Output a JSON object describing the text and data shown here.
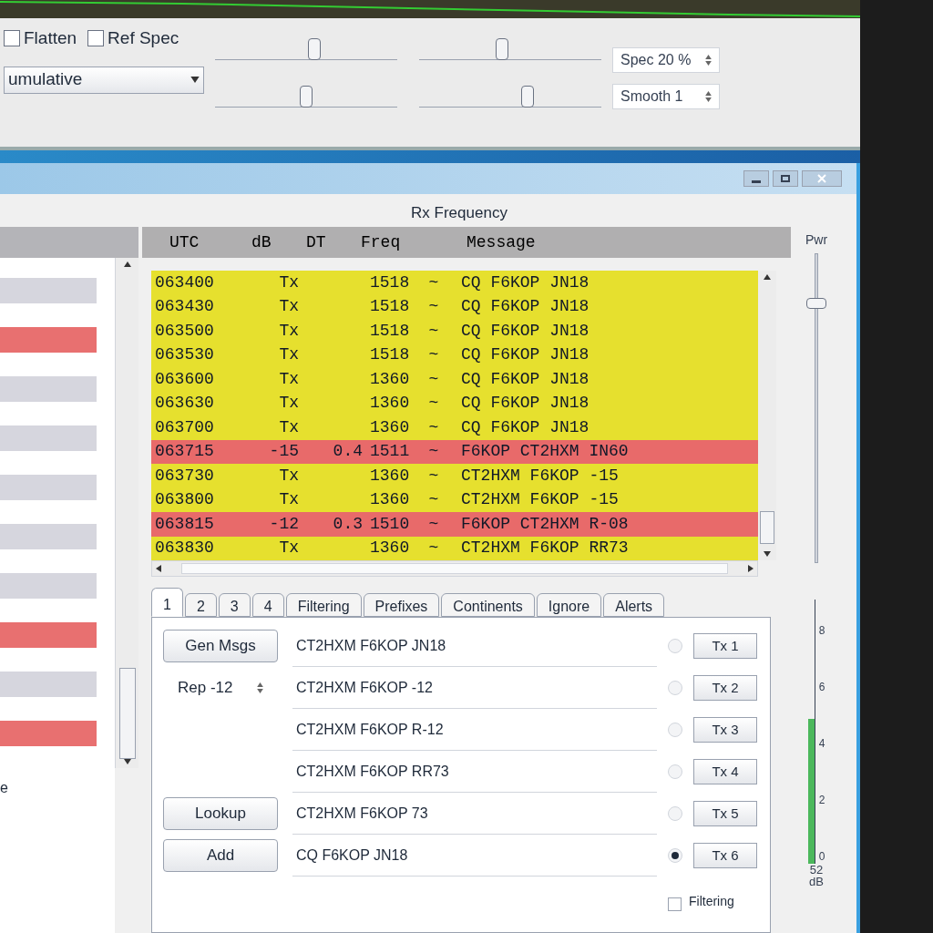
{
  "spectrum_window": {
    "checkboxes": [
      {
        "label": "Flatten",
        "checked": false
      },
      {
        "label": "Ref Spec",
        "checked": false
      }
    ],
    "mode_dropdown": {
      "value": "umulative"
    },
    "sliders": [
      {
        "level": 0.55
      },
      {
        "level": 0.45
      },
      {
        "level": 0.5
      },
      {
        "level": 0.6
      }
    ],
    "spinners": [
      {
        "label": "Spec 20 %"
      },
      {
        "label": "Smooth 1"
      }
    ]
  },
  "band_activity": {
    "rows": [
      {
        "color": "#d6d6de"
      },
      {
        "color": "#e87070"
      },
      {
        "color": "#d6d6de"
      },
      {
        "color": "#d6d6de"
      },
      {
        "color": "#d6d6de"
      },
      {
        "color": "#d6d6de"
      },
      {
        "color": "#d6d6de"
      },
      {
        "color": "#e87070"
      },
      {
        "color": "#d6d6de"
      },
      {
        "color": "#e87070"
      }
    ],
    "footer": "e"
  },
  "rx_frequency": {
    "title": "Rx Frequency",
    "columns": [
      "UTC",
      "dB",
      "DT",
      "Freq",
      "Message"
    ],
    "rows": [
      {
        "utc": "063400",
        "db": "Tx",
        "dt": "",
        "freq": "1518",
        "mode": "~",
        "message": "CQ F6KOP JN18",
        "color": "#e6e02e"
      },
      {
        "utc": "063430",
        "db": "Tx",
        "dt": "",
        "freq": "1518",
        "mode": "~",
        "message": "CQ F6KOP JN18",
        "color": "#e6e02e"
      },
      {
        "utc": "063500",
        "db": "Tx",
        "dt": "",
        "freq": "1518",
        "mode": "~",
        "message": "CQ F6KOP JN18",
        "color": "#e6e02e"
      },
      {
        "utc": "063530",
        "db": "Tx",
        "dt": "",
        "freq": "1518",
        "mode": "~",
        "message": "CQ F6KOP JN18",
        "color": "#e6e02e"
      },
      {
        "utc": "063600",
        "db": "Tx",
        "dt": "",
        "freq": "1360",
        "mode": "~",
        "message": "CQ F6KOP JN18",
        "color": "#e6e02e"
      },
      {
        "utc": "063630",
        "db": "Tx",
        "dt": "",
        "freq": "1360",
        "mode": "~",
        "message": "CQ F6KOP JN18",
        "color": "#e6e02e"
      },
      {
        "utc": "063700",
        "db": "Tx",
        "dt": "",
        "freq": "1360",
        "mode": "~",
        "message": "CQ F6KOP JN18",
        "color": "#e6e02e"
      },
      {
        "utc": "063715",
        "db": "-15",
        "dt": "0.4",
        "freq": "1511",
        "mode": "~",
        "message": "F6KOP CT2HXM IN60",
        "color": "#e86a6a"
      },
      {
        "utc": "063730",
        "db": "Tx",
        "dt": "",
        "freq": "1360",
        "mode": "~",
        "message": "CT2HXM F6KOP -15",
        "color": "#e6e02e"
      },
      {
        "utc": "063800",
        "db": "Tx",
        "dt": "",
        "freq": "1360",
        "mode": "~",
        "message": "CT2HXM F6KOP -15",
        "color": "#e6e02e"
      },
      {
        "utc": "063815",
        "db": "-12",
        "dt": "0.3",
        "freq": "1510",
        "mode": "~",
        "message": "F6KOP CT2HXM R-08",
        "color": "#e86a6a"
      },
      {
        "utc": "063830",
        "db": "Tx",
        "dt": "",
        "freq": "1360",
        "mode": "~",
        "message": "CT2HXM F6KOP RR73",
        "color": "#e6e02e"
      }
    ]
  },
  "tabs": [
    {
      "label": "1",
      "selected": true
    },
    {
      "label": "2",
      "selected": false
    },
    {
      "label": "3",
      "selected": false
    },
    {
      "label": "4",
      "selected": false
    },
    {
      "label": "Filtering",
      "selected": false
    },
    {
      "label": "Prefixes",
      "selected": false
    },
    {
      "label": "Continents",
      "selected": false
    },
    {
      "label": "Ignore",
      "selected": false
    },
    {
      "label": "Alerts",
      "selected": false
    }
  ],
  "tx_panel": {
    "left": [
      {
        "kind": "button",
        "label": "Gen Msgs"
      },
      {
        "kind": "spinner",
        "label": "Rep -12"
      },
      {
        "kind": "empty"
      },
      {
        "kind": "empty"
      },
      {
        "kind": "button",
        "label": "Lookup"
      },
      {
        "kind": "button",
        "label": "Add"
      }
    ],
    "messages": [
      {
        "text": "CT2HXM F6KOP JN18",
        "button": "Tx 1",
        "selected": false
      },
      {
        "text": "CT2HXM F6KOP -12",
        "button": "Tx 2",
        "selected": false
      },
      {
        "text": "CT2HXM F6KOP R-12",
        "button": "Tx 3",
        "selected": false
      },
      {
        "text": "CT2HXM F6KOP RR73",
        "button": "Tx 4",
        "selected": false
      },
      {
        "text": "CT2HXM F6KOP 73",
        "button": "Tx 5",
        "selected": false
      },
      {
        "text": "CQ F6KOP JN18",
        "button": "Tx 6",
        "selected": true
      }
    ],
    "filtering": {
      "label": "Filtering",
      "checked": false
    }
  },
  "power": {
    "label": "Pwr",
    "level": 0.85
  },
  "meter": {
    "level": 0.55,
    "ticks": [
      "8",
      "6",
      "4",
      "2",
      "0"
    ],
    "reading": "52",
    "unit": "dB"
  }
}
